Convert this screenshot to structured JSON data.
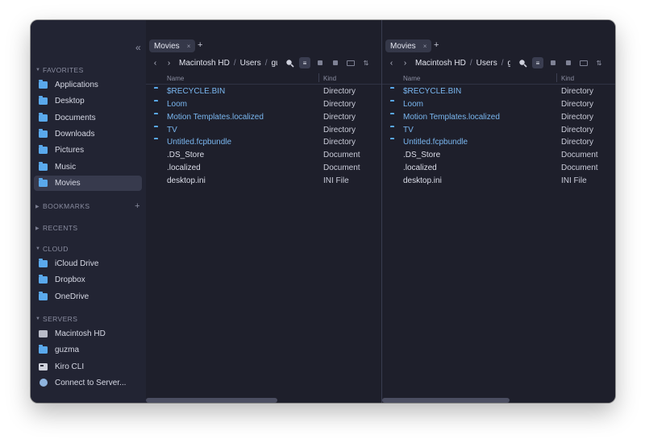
{
  "colors": {
    "close": "#ff5f57",
    "minimize": "#febc2e",
    "zoom": "#28c840",
    "folder": "#5aa9ec",
    "directory_text": "#7ab7f0"
  },
  "sidebar": {
    "collapse_icon": "«",
    "favorites": {
      "title": "FAVORITES",
      "items": [
        {
          "label": "Applications",
          "icon": "folder-icon"
        },
        {
          "label": "Desktop",
          "icon": "folder-icon"
        },
        {
          "label": "Documents",
          "icon": "folder-icon"
        },
        {
          "label": "Downloads",
          "icon": "folder-icon"
        },
        {
          "label": "Pictures",
          "icon": "folder-icon"
        },
        {
          "label": "Music",
          "icon": "folder-icon"
        },
        {
          "label": "Movies",
          "icon": "folder-icon",
          "active": true
        }
      ]
    },
    "bookmarks": {
      "title": "BOOKMARKS",
      "add": "+"
    },
    "recents": {
      "title": "RECENTS"
    },
    "cloud": {
      "title": "CLOUD",
      "items": [
        {
          "label": "iCloud Drive",
          "icon": "folder-icon"
        },
        {
          "label": "Dropbox",
          "icon": "folder-icon"
        },
        {
          "label": "OneDrive",
          "icon": "folder-icon"
        }
      ]
    },
    "servers": {
      "title": "SERVERS",
      "items": [
        {
          "label": "Macintosh HD",
          "icon": "drive-icon"
        },
        {
          "label": "guzma",
          "icon": "folder-icon"
        },
        {
          "label": "Kiro CLI",
          "icon": "terminal-icon"
        },
        {
          "label": "Connect to Server...",
          "icon": "globe-icon"
        }
      ]
    }
  },
  "panes": [
    {
      "tab": {
        "label": "Movies",
        "close": "×"
      },
      "add_tab": "+",
      "nav": {
        "back": "‹",
        "forward": "›"
      },
      "breadcrumb": [
        "Macintosh HD",
        "Users",
        "guz"
      ],
      "columns": {
        "name": "Name",
        "kind": "Kind"
      },
      "files": [
        {
          "name": "$RECYCLE.BIN",
          "kind": "Directory",
          "type": "dir"
        },
        {
          "name": "Loom",
          "kind": "Directory",
          "type": "dir"
        },
        {
          "name": "Motion Templates.localized",
          "kind": "Directory",
          "type": "dir"
        },
        {
          "name": "TV",
          "kind": "Directory",
          "type": "dir"
        },
        {
          "name": "Untitled.fcpbundle",
          "kind": "Directory",
          "type": "dir"
        },
        {
          "name": ".DS_Store",
          "kind": "Document",
          "type": "doc"
        },
        {
          "name": ".localized",
          "kind": "Document",
          "type": "doc"
        },
        {
          "name": "desktop.ini",
          "kind": "INI File",
          "type": "ini"
        }
      ]
    },
    {
      "tab": {
        "label": "Movies",
        "close": "×"
      },
      "add_tab": "+",
      "nav": {
        "back": "‹",
        "forward": "›"
      },
      "breadcrumb": [
        "Macintosh HD",
        "Users",
        "gu"
      ],
      "columns": {
        "name": "Name",
        "kind": "Kind"
      },
      "files": [
        {
          "name": "$RECYCLE.BIN",
          "kind": "Directory",
          "type": "dir"
        },
        {
          "name": "Loom",
          "kind": "Directory",
          "type": "dir"
        },
        {
          "name": "Motion Templates.localized",
          "kind": "Directory",
          "type": "dir"
        },
        {
          "name": "TV",
          "kind": "Directory",
          "type": "dir"
        },
        {
          "name": "Untitled.fcpbundle",
          "kind": "Directory",
          "type": "dir"
        },
        {
          "name": ".DS_Store",
          "kind": "Document",
          "type": "doc"
        },
        {
          "name": ".localized",
          "kind": "Document",
          "type": "doc"
        },
        {
          "name": "desktop.ini",
          "kind": "INI File",
          "type": "ini"
        }
      ]
    }
  ]
}
